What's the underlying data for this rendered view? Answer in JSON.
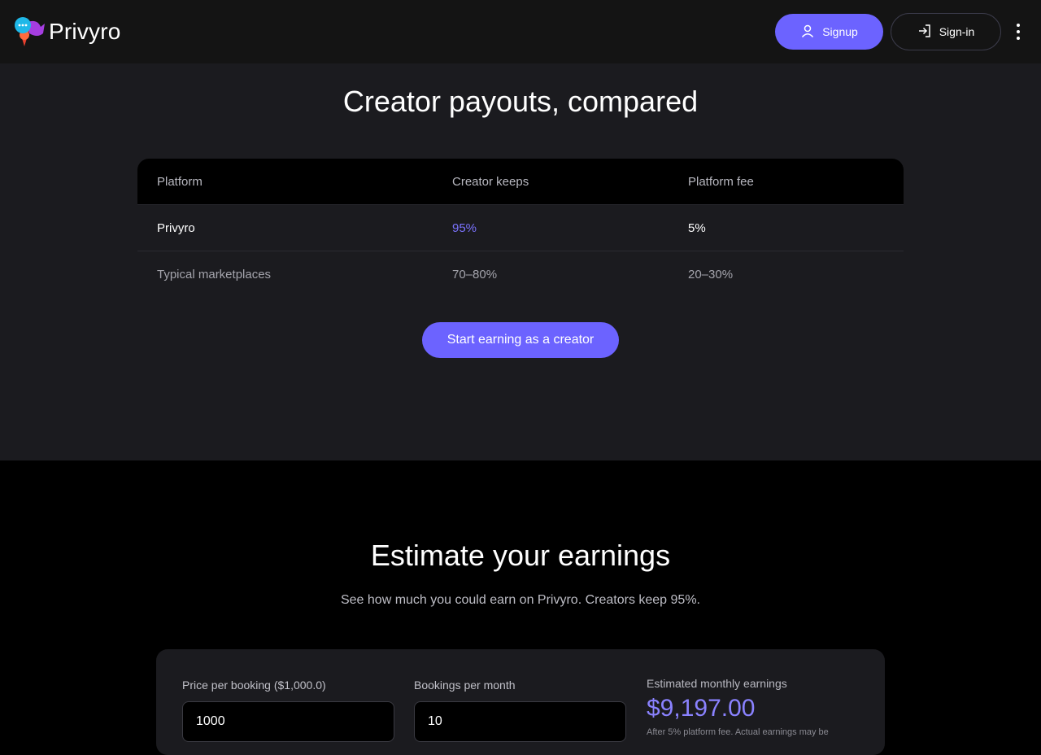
{
  "header": {
    "brand": "Privyro",
    "signup_label": "Signup",
    "signin_label": "Sign-in"
  },
  "payout": {
    "title": "Creator payouts, compared",
    "columns": [
      "Platform",
      "Creator keeps",
      "Platform fee"
    ],
    "rows": [
      [
        "Privyro",
        "95%",
        "5%"
      ],
      [
        "Typical marketplaces",
        "70–80%",
        "20–30%"
      ]
    ],
    "cta_label": "Start earning as a creator"
  },
  "estimate": {
    "title": "Estimate your earnings",
    "subtitle": "See how much you could earn on Privyro. Creators keep 95%.",
    "price_label": "Price per booking ($1,000.0)",
    "price_value": "1000",
    "bookings_label": "Bookings per month",
    "bookings_value": "10",
    "result_label": "Estimated monthly earnings",
    "result_value": "$9,197.00",
    "result_note": "After 5% platform fee. Actual earnings may be"
  },
  "colors": {
    "accent": "#6c63ff",
    "accent_text": "#7b73ff",
    "header_bg": "#141414",
    "section_bg": "#1b1b1f"
  }
}
